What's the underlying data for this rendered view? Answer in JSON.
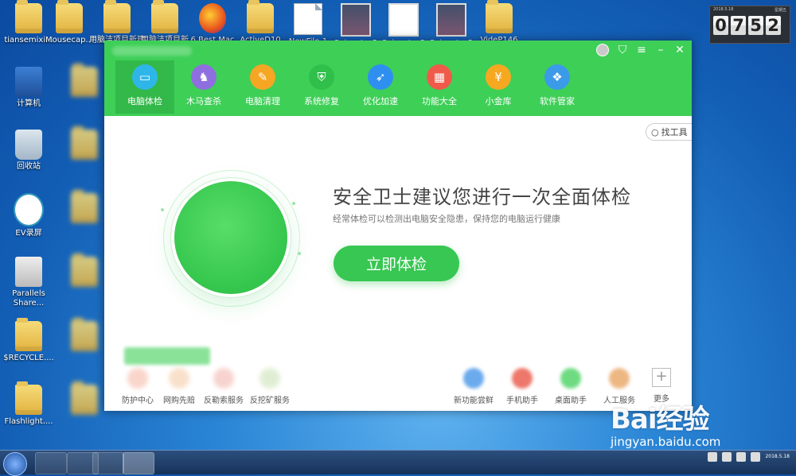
{
  "desktop": {
    "icons": [
      {
        "label": "tiansemixi...",
        "kind": "user"
      },
      {
        "label": "Mousecap...",
        "kind": "folder"
      },
      {
        "label": "用脑洁项目新建",
        "kind": "folder"
      },
      {
        "label": "用脑洁项目新",
        "kind": "folder"
      },
      {
        "label": "6 Best Mac",
        "kind": "firefox"
      },
      {
        "label": "ActiveD10",
        "kind": "folder"
      },
      {
        "label": "NewFile-1",
        "kind": "doc"
      },
      {
        "label": "Snipaste_2",
        "kind": "shot"
      },
      {
        "label": "Snipaste_2",
        "kind": "shot-light"
      },
      {
        "label": "Snipaste_2",
        "kind": "shot"
      },
      {
        "label": "VideP146",
        "kind": "folder"
      },
      {
        "label": "计算机",
        "kind": "pc"
      },
      {
        "label": "回收站",
        "kind": "bin"
      },
      {
        "label": "EV录屏",
        "kind": "ev"
      },
      {
        "label": "Parallels Share...",
        "kind": "par"
      },
      {
        "label": "$RECYCLE....",
        "kind": "folder"
      },
      {
        "label": "Flashlight....",
        "kind": "folder"
      }
    ]
  },
  "clock": {
    "digits": [
      "0",
      "7",
      "5",
      "2"
    ],
    "date": "2018.5.18",
    "weekday": "星期五"
  },
  "app": {
    "nav": [
      {
        "label": "电脑体检",
        "color": "#2fb6e8",
        "icon": "monitor-icon",
        "glyph": "▭"
      },
      {
        "label": "木马查杀",
        "color": "#8f6fe0",
        "icon": "horse-icon",
        "glyph": "♞"
      },
      {
        "label": "电脑清理",
        "color": "#f5a623",
        "icon": "broom-icon",
        "glyph": "✎"
      },
      {
        "label": "系统修复",
        "color": "#2fbf4a",
        "icon": "shield-icon",
        "glyph": "⛨"
      },
      {
        "label": "优化加速",
        "color": "#2f8ff0",
        "icon": "rocket-icon",
        "glyph": "➶"
      },
      {
        "label": "功能大全",
        "color": "#f05a4a",
        "icon": "grid-icon",
        "glyph": "▦"
      },
      {
        "label": "小金库",
        "color": "#f6a821",
        "icon": "coin-icon",
        "glyph": "¥"
      },
      {
        "label": "软件管家",
        "color": "#3c9be8",
        "icon": "apps-icon",
        "glyph": "❖"
      }
    ],
    "search_label": "找工具",
    "headline": "安全卫士建议您进行一次全面体检",
    "subline": "经常体检可以检测出电脑安全隐患，保持您的电脑运行健康",
    "scan_button": "立即体检",
    "bottom_left": [
      "防护中心",
      "网购先赔",
      "反勒索服务",
      "反挖矿服务"
    ],
    "bottom_right": [
      "新功能尝鲜",
      "手机助手",
      "桌面助手",
      "人工服务",
      "更多"
    ],
    "more_glyph": "+"
  },
  "watermark": {
    "logo": "Bai经验",
    "url": "jingyan.baidu.com"
  }
}
